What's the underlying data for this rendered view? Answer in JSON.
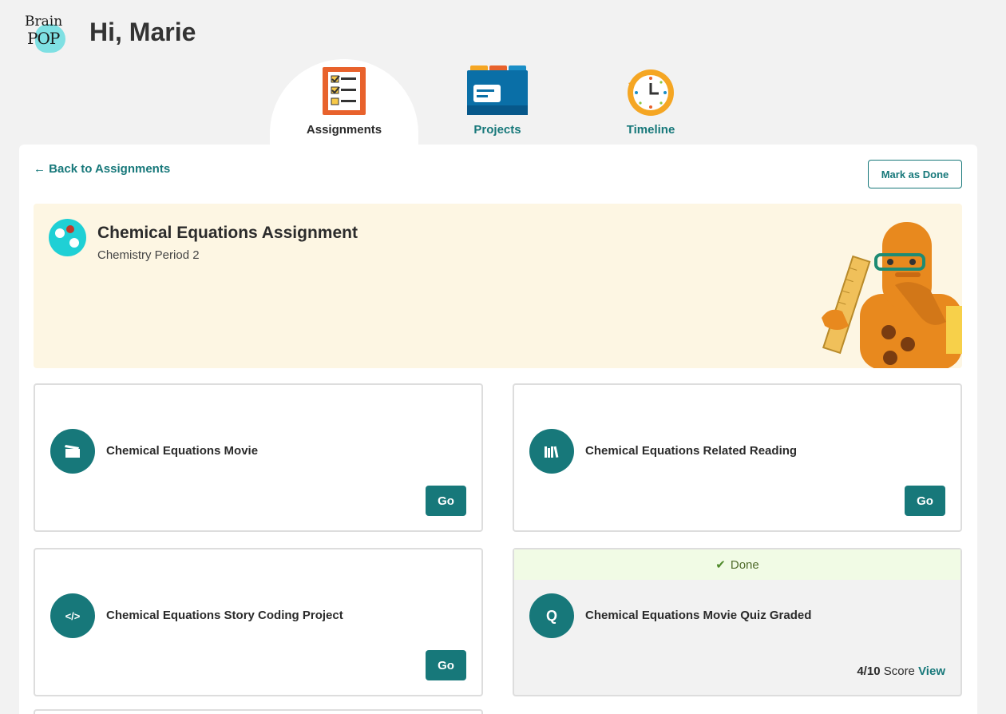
{
  "brand": {
    "line1": "Brain",
    "line2": "POP"
  },
  "header": {
    "greeting": "Hi, Marie"
  },
  "tabs": [
    {
      "label": "Assignments",
      "icon": "checklist-icon",
      "active": true
    },
    {
      "label": "Projects",
      "icon": "folder-icon",
      "active": false
    },
    {
      "label": "Timeline",
      "icon": "clock-icon",
      "active": false
    }
  ],
  "nav": {
    "back_label": "Back to Assignments",
    "mark_done_label": "Mark as Done"
  },
  "assignment": {
    "title": "Chemical Equations Assignment",
    "class_name": "Chemistry Period 2"
  },
  "cards": [
    {
      "title": "Chemical Equations Movie",
      "icon": "clapperboard-icon",
      "go_label": "Go"
    },
    {
      "title": "Chemical Equations Related Reading",
      "icon": "books-icon",
      "go_label": "Go"
    },
    {
      "title": "Chemical Equations Story Coding Project",
      "icon": "code-icon",
      "go_label": "Go"
    },
    {
      "title": "Chemical Equations Movie Quiz Graded",
      "icon": "quiz-icon",
      "icon_text": "Q",
      "status": "Done",
      "score_value": "4/10",
      "score_label": "Score",
      "view_label": "View"
    }
  ],
  "colors": {
    "accent": "#17787a",
    "banner_bg": "#fdf6e3",
    "done_bg": "#f1fbe5",
    "page_bg": "#f2f2f2"
  }
}
